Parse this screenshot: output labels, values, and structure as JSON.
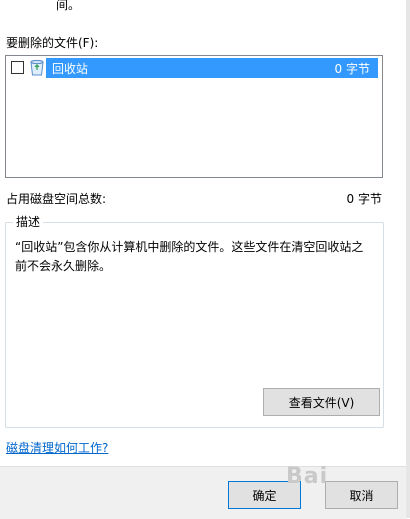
{
  "header": {
    "fragment": "间。"
  },
  "files_section": {
    "label": "要删除的文件(F):"
  },
  "file_list": {
    "items": [
      {
        "name": "回收站",
        "size": "0 字节",
        "checked": false,
        "selected": true
      }
    ]
  },
  "total": {
    "label": "占用磁盘空间总数:",
    "value": "0 字节"
  },
  "description": {
    "title": "描述",
    "text": "“回收站”包含你从计算机中删除的文件。这些文件在清空回收站之前不会永久删除。",
    "view_button": "查看文件(V)"
  },
  "help_link": "磁盘清理如何工作?",
  "footer": {
    "ok": "确定",
    "cancel": "取消"
  },
  "watermark": "Bai"
}
